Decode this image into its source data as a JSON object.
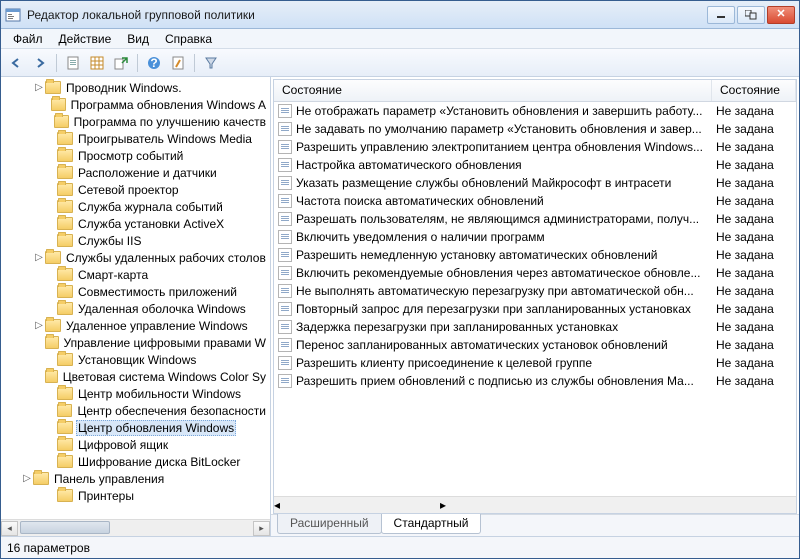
{
  "window": {
    "title": "Редактор локальной групповой политики"
  },
  "menu": {
    "file": "Файл",
    "action": "Действие",
    "view": "Вид",
    "help": "Справка"
  },
  "tree": {
    "items": [
      {
        "indent": 30,
        "tw": "▷",
        "label": "Проводник Windows."
      },
      {
        "indent": 42,
        "tw": "",
        "label": "Программа обновления Windows A"
      },
      {
        "indent": 42,
        "tw": "",
        "label": "Программа по улучшению качеств"
      },
      {
        "indent": 42,
        "tw": "",
        "label": "Проигрыватель Windows Media"
      },
      {
        "indent": 42,
        "tw": "",
        "label": "Просмотр событий"
      },
      {
        "indent": 42,
        "tw": "",
        "label": "Расположение и датчики"
      },
      {
        "indent": 42,
        "tw": "",
        "label": "Сетевой проектор"
      },
      {
        "indent": 42,
        "tw": "",
        "label": "Служба журнала событий"
      },
      {
        "indent": 42,
        "tw": "",
        "label": "Служба установки ActiveX"
      },
      {
        "indent": 42,
        "tw": "",
        "label": "Службы IIS"
      },
      {
        "indent": 30,
        "tw": "▷",
        "label": "Службы удаленных рабочих столов"
      },
      {
        "indent": 42,
        "tw": "",
        "label": "Смарт-карта"
      },
      {
        "indent": 42,
        "tw": "",
        "label": "Совместимость приложений"
      },
      {
        "indent": 42,
        "tw": "",
        "label": "Удаленная оболочка Windows"
      },
      {
        "indent": 30,
        "tw": "▷",
        "label": "Удаленное управление Windows"
      },
      {
        "indent": 42,
        "tw": "",
        "label": "Управление цифровыми правами W"
      },
      {
        "indent": 42,
        "tw": "",
        "label": "Установщик Windows"
      },
      {
        "indent": 42,
        "tw": "",
        "label": "Цветовая система Windows Color Sy"
      },
      {
        "indent": 42,
        "tw": "",
        "label": "Центр мобильности Windows"
      },
      {
        "indent": 42,
        "tw": "",
        "label": "Центр обеспечения безопасности"
      },
      {
        "indent": 42,
        "tw": "",
        "label": "Центр обновления Windows",
        "selected": true
      },
      {
        "indent": 42,
        "tw": "",
        "label": "Цифровой ящик"
      },
      {
        "indent": 42,
        "tw": "",
        "label": "Шифрование диска BitLocker"
      },
      {
        "indent": 18,
        "tw": "▷",
        "label": "Панель управления"
      },
      {
        "indent": 42,
        "tw": "",
        "label": "Принтеры"
      }
    ]
  },
  "list": {
    "col_name": "Состояние",
    "col_state": "Состояние",
    "state_value": "Не задана",
    "items": [
      "Не отображать параметр «Установить обновления и завершить работу...",
      "Не задавать по умолчанию параметр «Установить обновления и завер...",
      "Разрешить управлению электропитанием центра обновления Windows...",
      "Настройка автоматического обновления",
      "Указать размещение службы обновлений Майкрософт в интрасети",
      "Частота поиска автоматических обновлений",
      "Разрешать пользователям, не являющимся администраторами, получ...",
      "Включить уведомления о наличии программ",
      "Разрешить немедленную установку автоматических обновлений",
      "Включить рекомендуемые обновления через автоматическое обновле...",
      "Не выполнять автоматическую перезагрузку при автоматической обн...",
      "Повторный запрос для перезагрузки при запланированных установках",
      "Задержка перезагрузки при запланированных установках",
      "Перенос запланированных автоматических установок обновлений",
      "Разрешить клиенту присоединение к целевой группе",
      "Разрешить прием обновлений с подписью из службы обновления Ма..."
    ]
  },
  "tabs": {
    "extended": "Расширенный",
    "standard": "Стандартный"
  },
  "status": {
    "text": "16 параметров"
  }
}
